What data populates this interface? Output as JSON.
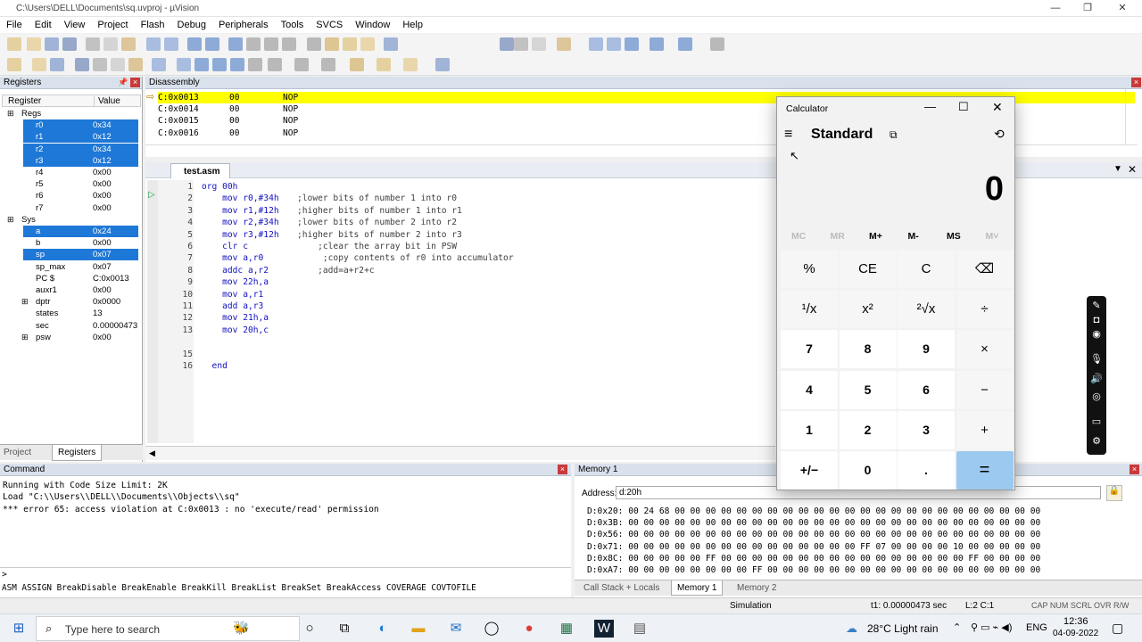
{
  "window": {
    "title": "C:\\Users\\DELL\\Documents\\sq.uvproj - µVision"
  },
  "menu": [
    "File",
    "Edit",
    "View",
    "Project",
    "Flash",
    "Debug",
    "Peripherals",
    "Tools",
    "SVCS",
    "Window",
    "Help"
  ],
  "registers": {
    "title": "Registers",
    "col_register": "Register",
    "col_value": "Value",
    "rows": [
      {
        "name": "Regs",
        "value": "",
        "indent": 1,
        "sel": false
      },
      {
        "name": "r0",
        "value": "0x34",
        "indent": 2,
        "sel": true
      },
      {
        "name": "r1",
        "value": "0x12",
        "indent": 2,
        "sel": true
      },
      {
        "name": "r2",
        "value": "0x34",
        "indent": 2,
        "sel": true
      },
      {
        "name": "r3",
        "value": "0x12",
        "indent": 2,
        "sel": true
      },
      {
        "name": "r4",
        "value": "0x00",
        "indent": 2,
        "sel": false
      },
      {
        "name": "r5",
        "value": "0x00",
        "indent": 2,
        "sel": false
      },
      {
        "name": "r6",
        "value": "0x00",
        "indent": 2,
        "sel": false
      },
      {
        "name": "r7",
        "value": "0x00",
        "indent": 2,
        "sel": false
      },
      {
        "name": "Sys",
        "value": "",
        "indent": 1,
        "sel": false
      },
      {
        "name": "a",
        "value": "0x24",
        "indent": 2,
        "sel": true
      },
      {
        "name": "b",
        "value": "0x00",
        "indent": 2,
        "sel": false
      },
      {
        "name": "sp",
        "value": "0x07",
        "indent": 2,
        "sel": true
      },
      {
        "name": "sp_max",
        "value": "0x07",
        "indent": 2,
        "sel": false
      },
      {
        "name": "PC  $",
        "value": "C:0x0013",
        "indent": 2,
        "sel": false
      },
      {
        "name": "auxr1",
        "value": "0x00",
        "indent": 2,
        "sel": false
      },
      {
        "name": "dptr",
        "value": "0x0000",
        "indent": 2,
        "sel": false
      },
      {
        "name": "states",
        "value": "13",
        "indent": 2,
        "sel": false
      },
      {
        "name": "sec",
        "value": "0.00000473",
        "indent": 2,
        "sel": false
      },
      {
        "name": "psw",
        "value": "0x00",
        "indent": 2,
        "sel": false
      }
    ],
    "tab_project": "Project",
    "tab_registers": "Registers"
  },
  "disassembly": {
    "title": "Disassembly",
    "lines": [
      {
        "addr": "C:0x0013",
        "op": "00",
        "mn": "NOP"
      },
      {
        "addr": "C:0x0014",
        "op": "00",
        "mn": "NOP"
      },
      {
        "addr": "C:0x0015",
        "op": "00",
        "mn": "NOP"
      },
      {
        "addr": "C:0x0016",
        "op": "00",
        "mn": "NOP"
      }
    ]
  },
  "editor": {
    "tab": "test.asm",
    "lines": [
      {
        "n": "1",
        "code": "org 00h",
        "c": ""
      },
      {
        "n": "2",
        "code": "    mov r0,#34h",
        "c": ";lower bits of number 1 into r0"
      },
      {
        "n": "3",
        "code": "    mov r1,#12h",
        "c": ";higher bits of number 1 into r1"
      },
      {
        "n": "4",
        "code": "    mov r2,#34h",
        "c": ";lower bits of number 2 into r2"
      },
      {
        "n": "5",
        "code": "    mov r3,#12h",
        "c": ";higher bits of number 2 into r3"
      },
      {
        "n": "6",
        "code": "    clr c",
        "c": "    ;clear the array bit in PSW"
      },
      {
        "n": "7",
        "code": "    mov a,r0",
        "c": "     ;copy contents of r0 into accumulator"
      },
      {
        "n": "8",
        "code": "    addc a,r2",
        "c": "    ;add=a+r2+c"
      },
      {
        "n": "9",
        "code": "    mov 22h,a",
        "c": ""
      },
      {
        "n": "10",
        "code": "    mov a,r1",
        "c": ""
      },
      {
        "n": "11",
        "code": "    add a,r3",
        "c": ""
      },
      {
        "n": "12",
        "code": "    mov 21h,a",
        "c": ""
      },
      {
        "n": "13",
        "code": "    mov 20h,c",
        "c": ""
      },
      {
        "n": "15",
        "code": "",
        "c": ""
      },
      {
        "n": "16",
        "code": "  end",
        "c": ""
      }
    ]
  },
  "command": {
    "title": "Command",
    "lines": [
      "Running with Code Size Limit: 2K",
      "Load \"C:\\\\Users\\\\DELL\\\\Documents\\\\Objects\\\\sq\"",
      "*** error 65: access violation at C:0x0013 : no 'execute/read' permission"
    ],
    "prompt": ">",
    "help": "ASM ASSIGN BreakDisable BreakEnable BreakKill BreakList BreakSet BreakAccess COVERAGE COVTOFILE"
  },
  "memory": {
    "title": "Memory 1",
    "address_label": "Address:",
    "address_value": "d:20h",
    "rows": [
      "D:0x20: 00 24 68 00 00 00 00 00 00 00 00 00 00 00 00 00 00 00 00 00 00 00 00 00 00 00 00",
      "D:0x3B: 00 00 00 00 00 00 00 00 00 00 00 00 00 00 00 00 00 00 00 00 00 00 00 00 00 00 00",
      "D:0x56: 00 00 00 00 00 00 00 00 00 00 00 00 00 00 00 00 00 00 00 00 00 00 00 00 00 00 00",
      "D:0x71: 00 00 00 00 00 00 00 00 00 00 00 00 00 00 00 FF 07 00 00 00 00 10 00 00 00 00 00",
      "D:0x8C: 00 00 00 00 00 FF 00 00 00 00 00 00 00 00 00 00 00 00 00 00 00 00 FF 00 00 00 00",
      "D:0xA7: 00 00 00 00 00 00 00 00 FF 00 00 00 00 00 00 00 00 00 00 00 00 00 00 00 00 00 00"
    ],
    "tabs": [
      "Call Stack + Locals",
      "Memory 1",
      "Memory 2"
    ]
  },
  "status": {
    "mode": "Simulation",
    "time": "t1: 0.00000473 sec",
    "pos": "L:2 C:1",
    "flags": "CAP  NUM  SCRL  OVR  R/W"
  },
  "calculator": {
    "title": "Calculator",
    "mode": "Standard",
    "display": "0",
    "mem": [
      "MC",
      "MR",
      "M+",
      "M-",
      "MS",
      "M˅"
    ],
    "keys": [
      [
        "%",
        "CE",
        "C",
        "⌫"
      ],
      [
        "¹/x",
        "x²",
        "²√x",
        "÷"
      ],
      [
        "7",
        "8",
        "9",
        "×"
      ],
      [
        "4",
        "5",
        "6",
        "−"
      ],
      [
        "1",
        "2",
        "3",
        "+"
      ],
      [
        "+/−",
        "0",
        ".",
        "="
      ]
    ]
  },
  "taskbar": {
    "search": "Type here to search",
    "weather": "28°C  Light rain",
    "lang": "ENG",
    "time": "12:36",
    "date": "04-09-2022"
  },
  "colors": {
    "highlight": "#ffff00",
    "select": "#1e78d7",
    "accent": "#9cc9ef"
  }
}
